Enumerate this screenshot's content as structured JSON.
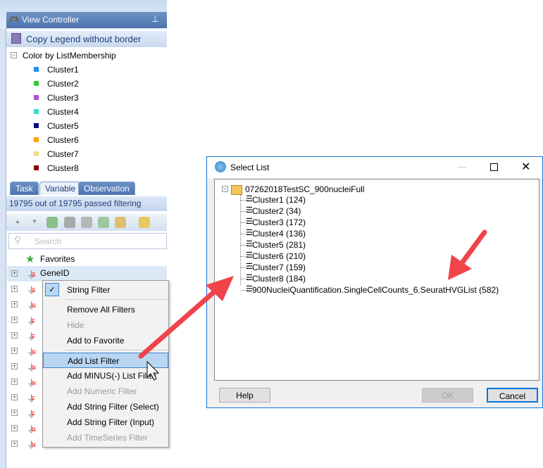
{
  "view_controller": {
    "title": "View Controller",
    "copy_legend": "Copy Legend  without border",
    "legend_title": "Color by ListMembership",
    "legend": [
      {
        "label": "Cluster1",
        "color": "#1e8ff5"
      },
      {
        "label": "Cluster2",
        "color": "#2ecc2e"
      },
      {
        "label": "Cluster3",
        "color": "#b14fd3"
      },
      {
        "label": "Cluster4",
        "color": "#3ddbc8"
      },
      {
        "label": "Cluster5",
        "color": "#0a0a80"
      },
      {
        "label": "Cluster6",
        "color": "#ffa000"
      },
      {
        "label": "Cluster7",
        "color": "#eee08c"
      },
      {
        "label": "Cluster8",
        "color": "#8a0000"
      }
    ]
  },
  "tabs": [
    "Task",
    "Variable",
    "Observation"
  ],
  "active_tab": "Variable",
  "status": "19795 out of 19795 passed filtering",
  "search": {
    "placeholder": "Search"
  },
  "variables": {
    "favorites": "Favorites",
    "rows": [
      {
        "label": "GeneID",
        "type": "S"
      },
      {
        "label": "",
        "type": "S"
      },
      {
        "label": "",
        "type": "N"
      },
      {
        "label": "",
        "type": "F"
      },
      {
        "label": "",
        "type": "F"
      },
      {
        "label": "",
        "type": "N"
      },
      {
        "label": "",
        "type": "N"
      },
      {
        "label": "",
        "type": "N"
      },
      {
        "label": "",
        "type": "F"
      },
      {
        "label": "",
        "type": "F"
      },
      {
        "label": "",
        "type": "N"
      },
      {
        "label": "",
        "type": "N"
      }
    ]
  },
  "context_menu": {
    "items": [
      {
        "label": "String Filter",
        "checked": true
      },
      {
        "label": "Remove All Filters"
      },
      {
        "label": "Hide",
        "disabled": true
      },
      {
        "label": "Add to Favorite"
      },
      {
        "label": "Add List Filter",
        "highlighted": true
      },
      {
        "label": "Add MINUS(-) List Filter"
      },
      {
        "label": "Add Numeric Filter",
        "disabled": true
      },
      {
        "label": "Add String Filter (Select)"
      },
      {
        "label": "Add String Filter (Input)"
      },
      {
        "label": "Add TimeSeries Filter",
        "disabled": true
      }
    ]
  },
  "dialog": {
    "title": "Select List",
    "root": "07262018TestSC_900nucleiFull",
    "lists": [
      "Cluster1 (124)",
      "Cluster2 (34)",
      "Cluster3 (172)",
      "Cluster4 (136)",
      "Cluster5 (281)",
      "Cluster6 (210)",
      "Cluster7 (159)",
      "Cluster8 (184)",
      "900NucleiQuantification.SingleCellCounts_6.SeuratHVGList (582)"
    ],
    "help": "Help",
    "ok": "OK",
    "cancel": "Cancel"
  },
  "annotation_color": "#f0434a"
}
